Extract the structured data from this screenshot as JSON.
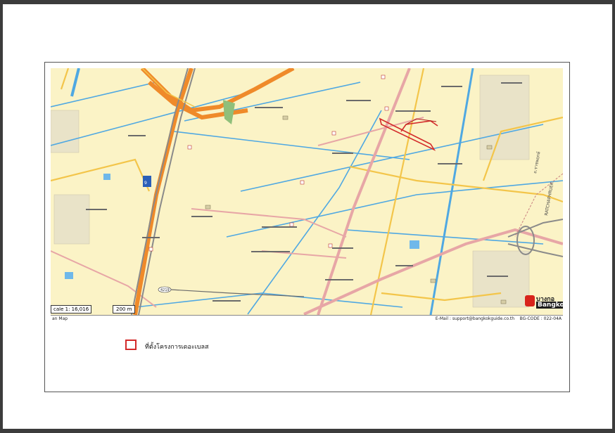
{
  "map": {
    "scale_text": "cale 1: 16,016",
    "scale_bar_text": "200 m",
    "footer_left": "an Map",
    "footer_email": "E-Mail : support@bangkokguide.co.th",
    "footer_code": "BG-CODE : 022-04A",
    "logo_line1": "บางกอ",
    "logo_line2": "Bangkok",
    "road_label": "RATCHAPHRUEK",
    "road_label_th": "ถ.ราชพฤกษ์",
    "highway_number": "9",
    "road_number": "4219",
    "colors": {
      "background": "#fbf3c6",
      "highway": "#ef8a2a",
      "major_road": "#e7a6a6",
      "yellow_road": "#f3c54a",
      "canal": "#4fa8e2",
      "project_outline": "#d32a2a"
    }
  },
  "legend": {
    "label": "ที่ตั้งโครงการเดอะเบลส",
    "swatch_color": "#d32a2a"
  }
}
